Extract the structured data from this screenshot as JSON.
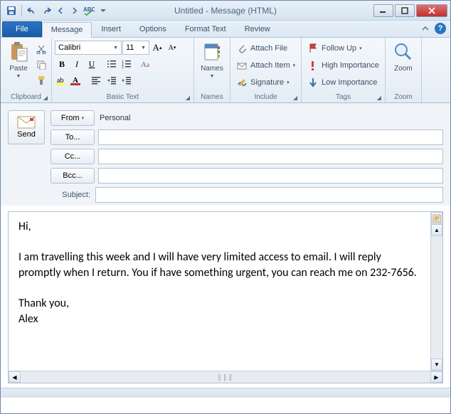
{
  "title": "Untitled - Message (HTML)",
  "tabs": {
    "file": "File",
    "message": "Message",
    "insert": "Insert",
    "options": "Options",
    "format": "Format Text",
    "review": "Review"
  },
  "ribbon": {
    "clipboard": {
      "label": "Clipboard",
      "paste": "Paste"
    },
    "basictext": {
      "label": "Basic Text",
      "font": "Calibri",
      "size": "11",
      "bold": "B",
      "italic": "I",
      "underline": "U"
    },
    "names": {
      "label": "Names",
      "btn": "Names"
    },
    "include": {
      "label": "Include",
      "attach_file": "Attach File",
      "attach_item": "Attach Item",
      "signature": "Signature"
    },
    "tags": {
      "label": "Tags",
      "follow_up": "Follow Up",
      "high": "High Importance",
      "low": "Low Importance"
    },
    "zoom": {
      "label": "Zoom",
      "btn": "Zoom"
    }
  },
  "compose": {
    "send": "Send",
    "from": "From",
    "from_value": "Personal",
    "to": "To...",
    "cc": "Cc...",
    "bcc": "Bcc...",
    "subject": "Subject:",
    "to_value": "",
    "cc_value": "",
    "bcc_value": "",
    "subject_value": ""
  },
  "body": "Hi,\n\nI am travelling this week and I will have very limited access to email. I will reply promptly when I return. You if have something urgent, you can reach me on 232-7656.\n\nThank you,\nAlex"
}
